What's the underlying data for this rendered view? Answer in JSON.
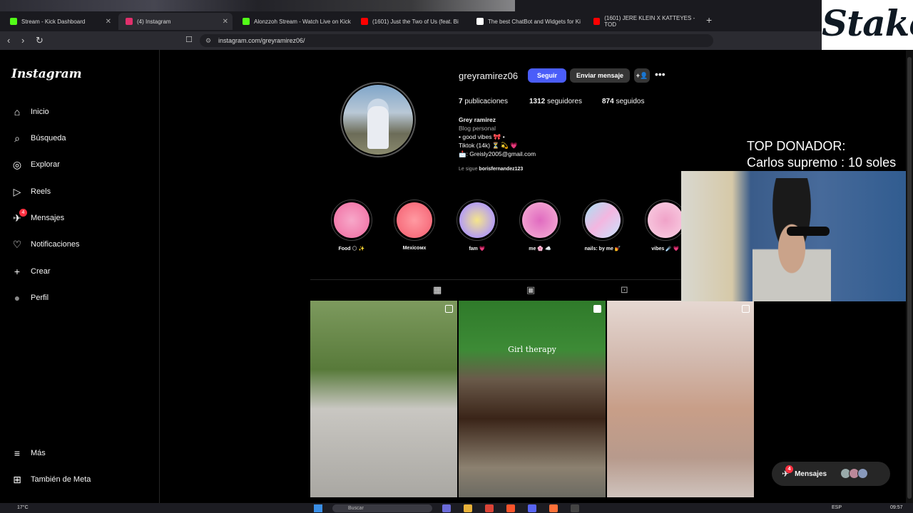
{
  "browser": {
    "tabs": [
      {
        "label": "Stream - Kick Dashboard",
        "fav_color": "#53fc18"
      },
      {
        "label": "(4) Instagram",
        "fav_color": "#e1306c"
      },
      {
        "label": "Alonzzoh Stream - Watch Live on Kick",
        "fav_color": "#53fc18"
      },
      {
        "label": "(1601) Just the Two of Us (feat. Bi",
        "fav_color": "#ff0000"
      },
      {
        "label": "The best ChatBot and Widgets for Ki",
        "fav_color": "#ffffff"
      },
      {
        "label": "(1601) JERE KLEIN X KATTEYES - TOD",
        "fav_color": "#ff0000"
      }
    ],
    "new_tab": "+",
    "url": "instagram.com/greyramirez06/"
  },
  "stake_logo": "Stake",
  "sidebar": {
    "logo": "Instagram",
    "items": [
      {
        "label": "Inicio",
        "icon": "home-icon",
        "glyph": "⌂"
      },
      {
        "label": "Búsqueda",
        "icon": "search-icon",
        "glyph": "⌕"
      },
      {
        "label": "Explorar",
        "icon": "compass-icon",
        "glyph": "◎"
      },
      {
        "label": "Reels",
        "icon": "reels-icon",
        "glyph": "▷"
      },
      {
        "label": "Mensajes",
        "icon": "messenger-icon",
        "glyph": "✈",
        "badge": "4"
      },
      {
        "label": "Notificaciones",
        "icon": "heart-icon",
        "glyph": "♡"
      },
      {
        "label": "Crear",
        "icon": "plus-icon",
        "glyph": "+"
      },
      {
        "label": "Perfil",
        "icon": "profile-avatar-icon",
        "glyph": "●"
      }
    ],
    "bottom": [
      {
        "label": "Más",
        "icon": "menu-icon",
        "glyph": "≡"
      },
      {
        "label": "También de Meta",
        "icon": "meta-icon",
        "glyph": "⊞"
      }
    ]
  },
  "profile": {
    "username": "greyramirez06",
    "follow_label": "Seguir",
    "message_label": "Enviar mensaje",
    "posts_count": "7",
    "posts_label": "publicaciones",
    "followers_count": "1312",
    "followers_label": "seguidores",
    "following_count": "874",
    "following_label": "seguidos",
    "name": "Grey ramirez",
    "category": "Blog personal",
    "bio_lines": [
      "• good vibes 🎀 •",
      "Tiktok (14k) ⏳ 💫 💗",
      "📩: Greisly2005@gmail.com"
    ],
    "followed_by_prefix": "Le sigue",
    "followed_by_user": "borisfernandez123"
  },
  "highlights": [
    {
      "label": "Food 🌕 ✨",
      "colors": [
        "#f7a8c9",
        "#f06aa0"
      ]
    },
    {
      "label": "Mexicoмх",
      "colors": [
        "#ff9aa2",
        "#f45c6e"
      ]
    },
    {
      "label": "fam 💗",
      "colors": [
        "#f5e58a",
        "#b59ef2"
      ]
    },
    {
      "label": "me 🌸 ☁️",
      "colors": [
        "#f7b3d6",
        "#e06bc0"
      ]
    },
    {
      "label": "nails: by me 💅",
      "colors": [
        "#a6e3f5",
        "#f3b6e0"
      ]
    },
    {
      "label": "vibes ☄️ 💗",
      "colors": [
        "#f9d1e4",
        "#f0a2c8"
      ]
    }
  ],
  "posts": [
    {
      "caption": ""
    },
    {
      "caption": "Girl therapy"
    },
    {
      "caption": ""
    }
  ],
  "overlay": {
    "donor_title": "TOP DONADOR:",
    "donor_line": "Carlos supremo : 10 soles"
  },
  "chat_widget": {
    "label": "Mensajes",
    "badge": "4"
  },
  "taskbar": {
    "weather": "17°C",
    "search_placeholder": "Buscar",
    "lang": "ESP",
    "time": "09:57"
  }
}
